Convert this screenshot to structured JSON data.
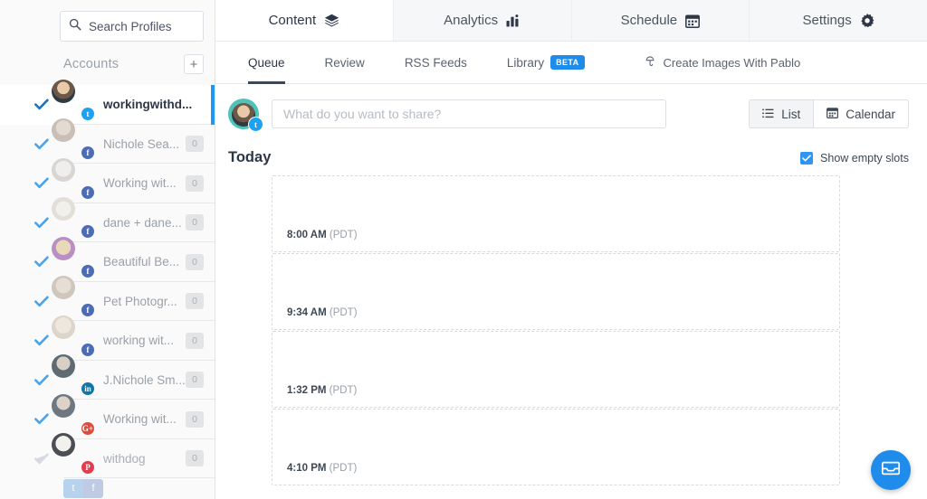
{
  "sidebar": {
    "search": {
      "placeholder": "Search Profiles",
      "value": "",
      "icon": "search-icon"
    },
    "accounts_label": "Accounts",
    "add_label": "+",
    "accounts": [
      {
        "name": "workingwithd...",
        "network": "twitter",
        "count": "",
        "checked": true,
        "active": true
      },
      {
        "name": "Nichole Sea...",
        "network": "facebook",
        "count": "0",
        "checked": true,
        "active": false
      },
      {
        "name": "Working wit...",
        "network": "facebook",
        "count": "0",
        "checked": true,
        "active": false
      },
      {
        "name": "dane + dane...",
        "network": "facebook",
        "count": "0",
        "checked": true,
        "active": false
      },
      {
        "name": "Beautiful Be...",
        "network": "facebook",
        "count": "0",
        "checked": true,
        "active": false
      },
      {
        "name": "Pet Photogr...",
        "network": "facebook",
        "count": "0",
        "checked": true,
        "active": false
      },
      {
        "name": "working wit...",
        "network": "facebook",
        "count": "0",
        "checked": true,
        "active": false
      },
      {
        "name": "J.Nichole Sm...",
        "network": "linkedin",
        "count": "0",
        "checked": true,
        "active": false
      },
      {
        "name": "Working wit...",
        "network": "gplus",
        "count": "0",
        "checked": true,
        "active": false
      },
      {
        "name": "withdog",
        "network": "pinterest",
        "count": "0",
        "checked": false,
        "active": false
      }
    ]
  },
  "topnav": [
    {
      "label": "Content",
      "icon": "layers-icon",
      "active": true
    },
    {
      "label": "Analytics",
      "icon": "bar-chart-icon",
      "active": false
    },
    {
      "label": "Schedule",
      "icon": "calendar-icon",
      "active": false
    },
    {
      "label": "Settings",
      "icon": "gear-icon",
      "active": false
    }
  ],
  "subnav": {
    "tabs": [
      {
        "label": "Queue",
        "active": true,
        "badge": ""
      },
      {
        "label": "Review",
        "active": false,
        "badge": ""
      },
      {
        "label": "RSS Feeds",
        "active": false,
        "badge": ""
      },
      {
        "label": "Library",
        "active": false,
        "badge": "BETA"
      }
    ],
    "pablo": {
      "label": "Create Images With Pablo",
      "icon": "pablo-icon"
    }
  },
  "composer": {
    "avatar_network": "twitter",
    "placeholder": "What do you want to share?",
    "value": "",
    "views": [
      {
        "label": "List",
        "icon": "list-icon",
        "active": true
      },
      {
        "label": "Calendar",
        "icon": "calendar-icon",
        "active": false
      }
    ]
  },
  "queue": {
    "today_label": "Today",
    "show_empty_label": "Show empty slots",
    "show_empty_checked": true,
    "slots": [
      {
        "time": "8:00 AM",
        "tz": "(PDT)"
      },
      {
        "time": "9:34 AM",
        "tz": "(PDT)"
      },
      {
        "time": "1:32 PM",
        "tz": "(PDT)"
      },
      {
        "time": "4:10 PM",
        "tz": "(PDT)"
      }
    ]
  },
  "chat": {
    "icon": "inbox-icon",
    "color": "#1f8ceb"
  },
  "colors": {
    "accent": "#1f8ceb",
    "check_active": "#1673c9",
    "check": "#4aa3e8",
    "text": "#3d4852",
    "muted": "#9aa1a9"
  }
}
